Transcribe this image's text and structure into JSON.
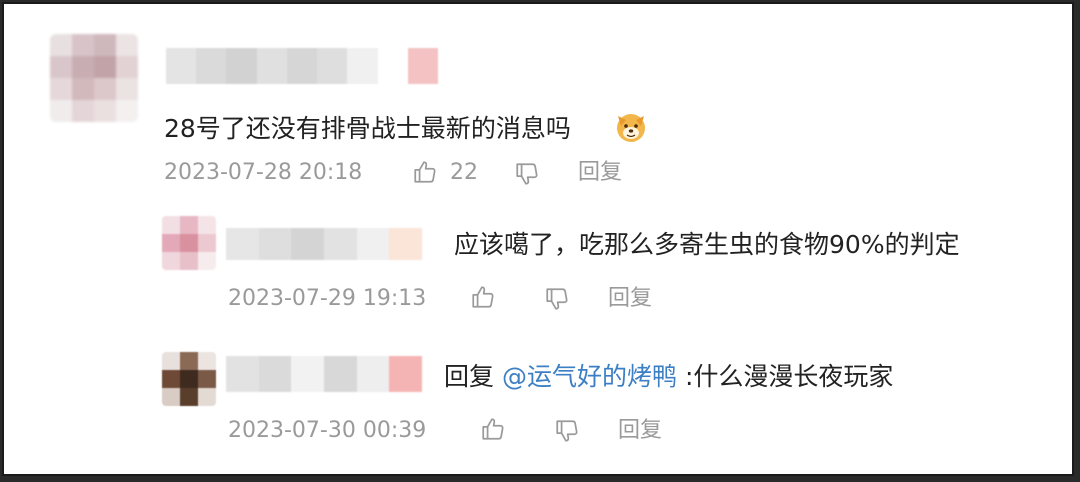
{
  "comments": [
    {
      "text": "28号了还没有排骨战士最新的消息吗",
      "emoji": "dog-face-emoji",
      "timestamp": "2023-07-28 20:18",
      "like_count": "22",
      "reply_label": "回复"
    }
  ],
  "replies": [
    {
      "text": "应该噶了，吃那么多寄生虫的食物90%的判定",
      "timestamp": "2023-07-29 19:13",
      "reply_label": "回复"
    },
    {
      "prefix": "回复",
      "mention": "@运气好的烤鸭",
      "text": ":什么漫漫长夜玩家",
      "timestamp": "2023-07-30 00:39",
      "reply_label": "回复"
    }
  ],
  "colors": {
    "text": "#222222",
    "meta": "#9a9a9a",
    "mention": "#3d7fc4"
  },
  "icons": {
    "like": "thumbs-up-icon",
    "dislike": "thumbs-down-icon"
  }
}
